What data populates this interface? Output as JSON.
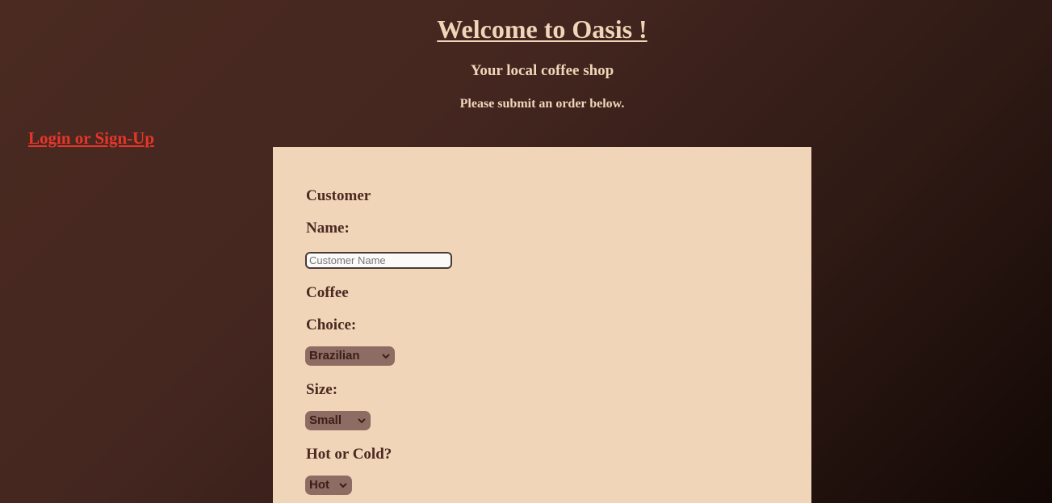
{
  "header": {
    "title": "Welcome to Oasis !",
    "subtitle": "Your local coffee shop",
    "instruction": "Please submit an order below."
  },
  "nav": {
    "login_label": "Login or Sign-Up"
  },
  "form": {
    "customer_label_line1": "Customer",
    "customer_label_line2": "Name:",
    "customer_name_placeholder": "Customer Name",
    "customer_name_value": "",
    "coffee_label_line1": "Coffee",
    "coffee_label_line2": "Choice:",
    "coffee_selected": "Brazilian",
    "size_label": "Size:",
    "size_selected": "Small",
    "temp_label": "Hot or Cold?",
    "temp_selected": "Hot"
  },
  "colors": {
    "background": "#4a2a21",
    "heading_text": "#f0d5b8",
    "link": "#e8352a",
    "card": "#f0d5b9",
    "label_text": "#4a2a21",
    "select_bg": "#8c6c63"
  },
  "icons": {
    "select_arrow": "chevron-down-icon"
  }
}
